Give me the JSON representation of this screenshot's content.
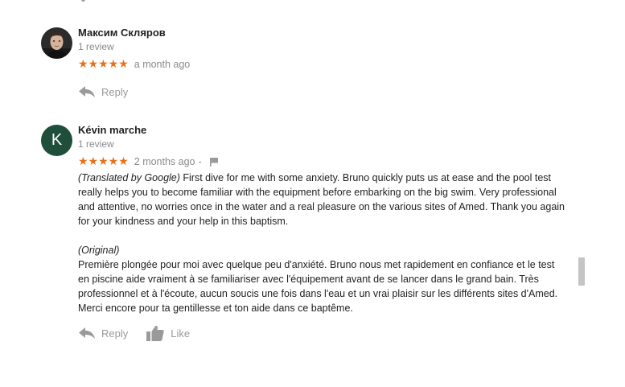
{
  "reviews": [
    {
      "author": "Максим Скляров",
      "review_count": "1 review",
      "stars": "★★★★★",
      "date": "a month ago",
      "avatar": "profile-photo",
      "actions": {
        "reply": "Reply"
      }
    },
    {
      "author": "Kévin marche",
      "review_count": "1 review",
      "avatar_letter": "K",
      "stars": "★★★★★",
      "date": "2 months ago",
      "separator": "-",
      "translated_label": "(Translated by Google)",
      "translated_text": " First dive for me with some anxiety. Bruno quickly puts us at ease and the pool test really helps you to become familiar with the equipment before embarking on the big swim. Very professional and attentive, no worries once in the water and a real pleasure on the various sites of Amed. Thank you again for your kindness and your help in this baptism.",
      "original_label": "(Original)",
      "original_text": "Première plongée pour moi avec quelque peu d'anxiété. Bruno nous met rapidement en confiance et le test en piscine aide vraiment à se familiariser avec l'équipement avant de se lancer dans le grand bain. Très professionnel et à l'écoute, aucun soucis une fois dans l'eau et un vrai plaisir sur les différents sites d'Amed. Merci encore pour ta gentillesse et ton aide dans ce baptême.",
      "actions": {
        "reply": "Reply",
        "like": "Like"
      }
    }
  ],
  "colors": {
    "star": "#e7711b",
    "muted": "#8a8a8a",
    "avatar_bg": "#1f4e3b"
  },
  "icons": {
    "reply": "reply-arrow-icon",
    "like": "thumbs-up-icon",
    "flag": "flag-icon"
  }
}
